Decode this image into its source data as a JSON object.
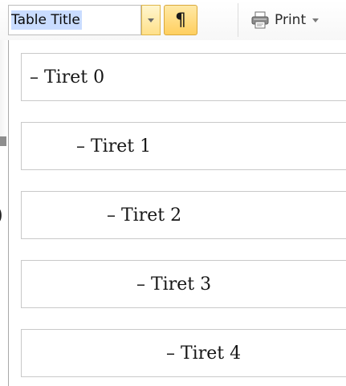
{
  "toolbar": {
    "style_value": "Table Title",
    "style_dropdown_icon": "chevron-down-icon",
    "pilcrow_label": "¶",
    "print_label": "Print",
    "print_icon": "printer-icon"
  },
  "style_gallery": {
    "items": [
      {
        "label": "–  Tiret 0"
      },
      {
        "label": "–  Tiret 1"
      },
      {
        "label": "–  Tiret 2"
      },
      {
        "label": "–  Tiret 3"
      },
      {
        "label": "–  Tiret 4"
      }
    ]
  },
  "background": {
    "edge_glyph": ")"
  },
  "colors": {
    "selection_highlight": "#c9dcff",
    "active_button": "#ffcf5f",
    "border": "#c9c9c9"
  }
}
